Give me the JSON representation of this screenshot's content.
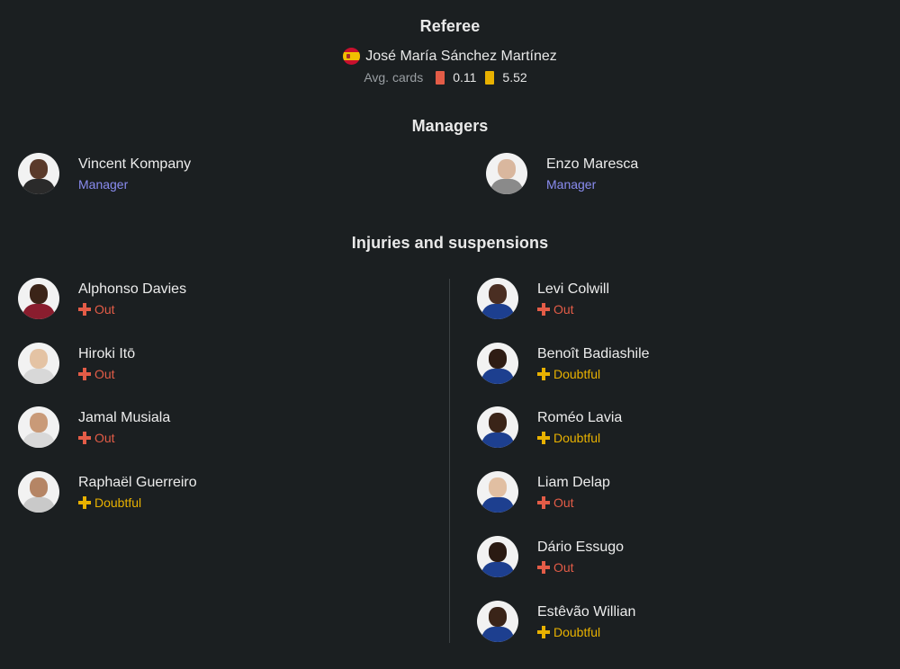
{
  "referee": {
    "heading": "Referee",
    "name": "José María Sánchez Martínez",
    "flag": "spain-flag",
    "avg_cards_label": "Avg. cards",
    "red_avg": "0.11",
    "yellow_avg": "5.52"
  },
  "managers": {
    "heading": "Managers",
    "home": {
      "name": "Vincent Kompany",
      "role": "Manager"
    },
    "away": {
      "name": "Enzo Maresca",
      "role": "Manager"
    }
  },
  "injuries": {
    "heading": "Injuries and suspensions",
    "home": [
      {
        "name": "Alphonso Davies",
        "status": "Out"
      },
      {
        "name": "Hiroki Itō",
        "status": "Out"
      },
      {
        "name": "Jamal Musiala",
        "status": "Out"
      },
      {
        "name": "Raphaël Guerreiro",
        "status": "Doubtful"
      }
    ],
    "away": [
      {
        "name": "Levi Colwill",
        "status": "Out"
      },
      {
        "name": "Benoît Badiashile",
        "status": "Doubtful"
      },
      {
        "name": "Roméo Lavia",
        "status": "Doubtful"
      },
      {
        "name": "Liam Delap",
        "status": "Out"
      },
      {
        "name": "Dário Essugo",
        "status": "Out"
      },
      {
        "name": "Estêvão Willian",
        "status": "Doubtful"
      }
    ]
  },
  "colors": {
    "background": "#1b1f21",
    "out": "#e35c47",
    "doubtful": "#e8b100",
    "manager_role": "#8a8cf0",
    "red_card": "#e35c47",
    "yellow_card": "#e8b100"
  }
}
